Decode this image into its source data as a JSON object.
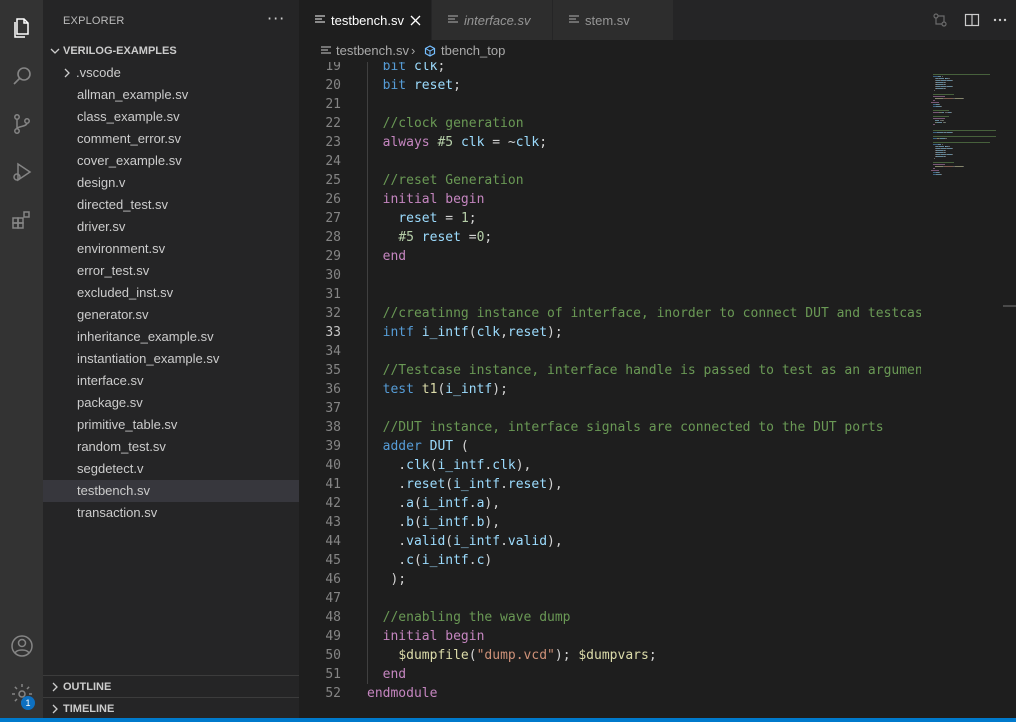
{
  "activity_bar": {
    "icons": [
      "explorer-icon",
      "search-icon",
      "source-control-icon",
      "run-debug-icon",
      "extensions-icon",
      "account-icon",
      "manage-gear-icon"
    ],
    "badge": "1"
  },
  "explorer": {
    "title": "EXPLORER",
    "more": "···",
    "folder": "VERILOG-EXAMPLES",
    "items": [
      {
        "label": ".vscode",
        "is_folder": true
      },
      {
        "label": "allman_example.sv"
      },
      {
        "label": "class_example.sv"
      },
      {
        "label": "comment_error.sv"
      },
      {
        "label": "cover_example.sv"
      },
      {
        "label": "design.v"
      },
      {
        "label": "directed_test.sv"
      },
      {
        "label": "driver.sv"
      },
      {
        "label": "environment.sv"
      },
      {
        "label": "error_test.sv"
      },
      {
        "label": "excluded_inst.sv"
      },
      {
        "label": "generator.sv"
      },
      {
        "label": "inheritance_example.sv"
      },
      {
        "label": "instantiation_example.sv"
      },
      {
        "label": "interface.sv"
      },
      {
        "label": "package.sv"
      },
      {
        "label": "primitive_table.sv"
      },
      {
        "label": "random_test.sv"
      },
      {
        "label": "segdetect.v"
      },
      {
        "label": "testbench.sv",
        "selected": true
      },
      {
        "label": "transaction.sv"
      }
    ],
    "outline": "OUTLINE",
    "timeline": "TIMELINE"
  },
  "tabs": [
    {
      "label": "testbench.sv",
      "active": true
    },
    {
      "label": "interface.sv",
      "italic": true
    },
    {
      "label": "stem.sv"
    }
  ],
  "breadcrumb": {
    "file": "testbench.sv",
    "separator": "›",
    "symbol": "tbench_top"
  },
  "editor": {
    "current_line": 33,
    "lines": [
      {
        "n": "19",
        "t": [
          [
            "  ",
            ""
          ],
          [
            "bit ",
            "kb"
          ],
          [
            "clk",
            "var"
          ],
          [
            ";",
            ""
          ]
        ]
      },
      {
        "n": "20",
        "t": [
          [
            "  ",
            ""
          ],
          [
            "bit ",
            "kb"
          ],
          [
            "reset",
            "var"
          ],
          [
            ";",
            ""
          ]
        ]
      },
      {
        "n": "21",
        "t": []
      },
      {
        "n": "22",
        "t": [
          [
            "  ",
            ""
          ],
          [
            "//clock generation",
            "cmt"
          ]
        ]
      },
      {
        "n": "23",
        "t": [
          [
            "  ",
            ""
          ],
          [
            "always ",
            "kw"
          ],
          [
            "#5 ",
            "num"
          ],
          [
            "clk",
            "var"
          ],
          [
            " = ~",
            ""
          ],
          [
            "clk",
            "var"
          ],
          [
            ";",
            ""
          ]
        ]
      },
      {
        "n": "24",
        "t": []
      },
      {
        "n": "25",
        "t": [
          [
            "  ",
            ""
          ],
          [
            "//reset Generation",
            "cmt"
          ]
        ]
      },
      {
        "n": "26",
        "t": [
          [
            "  ",
            ""
          ],
          [
            "initial ",
            "kw"
          ],
          [
            "begin",
            "kw"
          ]
        ]
      },
      {
        "n": "27",
        "t": [
          [
            "    ",
            ""
          ],
          [
            "reset",
            "var"
          ],
          [
            " = ",
            ""
          ],
          [
            "1",
            "num"
          ],
          [
            ";",
            ""
          ]
        ]
      },
      {
        "n": "28",
        "t": [
          [
            "    ",
            ""
          ],
          [
            "#5 ",
            "num"
          ],
          [
            "reset",
            "var"
          ],
          [
            " =",
            ""
          ],
          [
            "0",
            "num"
          ],
          [
            ";",
            ""
          ]
        ]
      },
      {
        "n": "29",
        "t": [
          [
            "  ",
            ""
          ],
          [
            "end",
            "kw"
          ]
        ]
      },
      {
        "n": "30",
        "t": []
      },
      {
        "n": "31",
        "t": []
      },
      {
        "n": "32",
        "t": [
          [
            "  ",
            ""
          ],
          [
            "//creatinng instance of interface, inorder to connect DUT and testcase",
            "cmt"
          ]
        ]
      },
      {
        "n": "33",
        "t": [
          [
            "  ",
            ""
          ],
          [
            "intf ",
            "kb"
          ],
          [
            "i_intf",
            "var"
          ],
          [
            "(",
            ""
          ],
          [
            "clk",
            "var"
          ],
          [
            ",",
            ""
          ],
          [
            "reset",
            "var"
          ],
          [
            ");",
            ""
          ]
        ]
      },
      {
        "n": "34",
        "t": []
      },
      {
        "n": "35",
        "t": [
          [
            "  ",
            ""
          ],
          [
            "//Testcase instance, interface handle is passed to test as an argument",
            "cmt"
          ]
        ]
      },
      {
        "n": "36",
        "t": [
          [
            "  ",
            ""
          ],
          [
            "test ",
            "kb"
          ],
          [
            "t1",
            "fn"
          ],
          [
            "(",
            ""
          ],
          [
            "i_intf",
            "var"
          ],
          [
            ");",
            ""
          ]
        ]
      },
      {
        "n": "37",
        "t": []
      },
      {
        "n": "38",
        "t": [
          [
            "  ",
            ""
          ],
          [
            "//DUT instance, interface signals are connected to the DUT ports",
            "cmt"
          ]
        ]
      },
      {
        "n": "39",
        "t": [
          [
            "  ",
            ""
          ],
          [
            "adder ",
            "kb"
          ],
          [
            "DUT",
            "var"
          ],
          [
            " (",
            ""
          ]
        ]
      },
      {
        "n": "40",
        "t": [
          [
            "    .",
            ""
          ],
          [
            "clk",
            "var"
          ],
          [
            "(",
            ""
          ],
          [
            "i_intf",
            "var"
          ],
          [
            ".",
            ""
          ],
          [
            "clk",
            "var"
          ],
          [
            "),",
            ""
          ]
        ]
      },
      {
        "n": "41",
        "t": [
          [
            "    .",
            ""
          ],
          [
            "reset",
            "var"
          ],
          [
            "(",
            ""
          ],
          [
            "i_intf",
            "var"
          ],
          [
            ".",
            ""
          ],
          [
            "reset",
            "var"
          ],
          [
            "),",
            ""
          ]
        ]
      },
      {
        "n": "42",
        "t": [
          [
            "    .",
            ""
          ],
          [
            "a",
            "var"
          ],
          [
            "(",
            ""
          ],
          [
            "i_intf",
            "var"
          ],
          [
            ".",
            ""
          ],
          [
            "a",
            "var"
          ],
          [
            "),",
            ""
          ]
        ]
      },
      {
        "n": "43",
        "t": [
          [
            "    .",
            ""
          ],
          [
            "b",
            "var"
          ],
          [
            "(",
            ""
          ],
          [
            "i_intf",
            "var"
          ],
          [
            ".",
            ""
          ],
          [
            "b",
            "var"
          ],
          [
            "),",
            ""
          ]
        ]
      },
      {
        "n": "44",
        "t": [
          [
            "    .",
            ""
          ],
          [
            "valid",
            "var"
          ],
          [
            "(",
            ""
          ],
          [
            "i_intf",
            "var"
          ],
          [
            ".",
            ""
          ],
          [
            "valid",
            "var"
          ],
          [
            "),",
            ""
          ]
        ]
      },
      {
        "n": "45",
        "t": [
          [
            "    .",
            ""
          ],
          [
            "c",
            "var"
          ],
          [
            "(",
            ""
          ],
          [
            "i_intf",
            "var"
          ],
          [
            ".",
            ""
          ],
          [
            "c",
            "var"
          ],
          [
            ")",
            ""
          ]
        ]
      },
      {
        "n": "46",
        "t": [
          [
            "   );",
            ""
          ]
        ]
      },
      {
        "n": "47",
        "t": []
      },
      {
        "n": "48",
        "t": [
          [
            "  ",
            ""
          ],
          [
            "//enabling the wave dump",
            "cmt"
          ]
        ]
      },
      {
        "n": "49",
        "t": [
          [
            "  ",
            ""
          ],
          [
            "initial ",
            "kw"
          ],
          [
            "begin",
            "kw"
          ]
        ]
      },
      {
        "n": "50",
        "t": [
          [
            "    ",
            ""
          ],
          [
            "$dumpfile",
            "fn"
          ],
          [
            "(",
            ""
          ],
          [
            "\"dump.vcd\"",
            "str"
          ],
          [
            "); ",
            ""
          ],
          [
            "$dumpvars",
            "fn"
          ],
          [
            ";",
            ""
          ]
        ]
      },
      {
        "n": "51",
        "t": [
          [
            "  ",
            ""
          ],
          [
            "end",
            "kw"
          ]
        ]
      },
      {
        "n": "52",
        "t": [
          [
            "endmodule",
            "kw"
          ]
        ]
      }
    ]
  },
  "colors": {
    "accent": "#007acc",
    "comment": "#6a9955",
    "keyword": "#c586c0",
    "type": "#569cd6",
    "variable": "#9cdcfe",
    "number": "#b5cea8",
    "string": "#ce9178",
    "function": "#dcdcaa"
  }
}
